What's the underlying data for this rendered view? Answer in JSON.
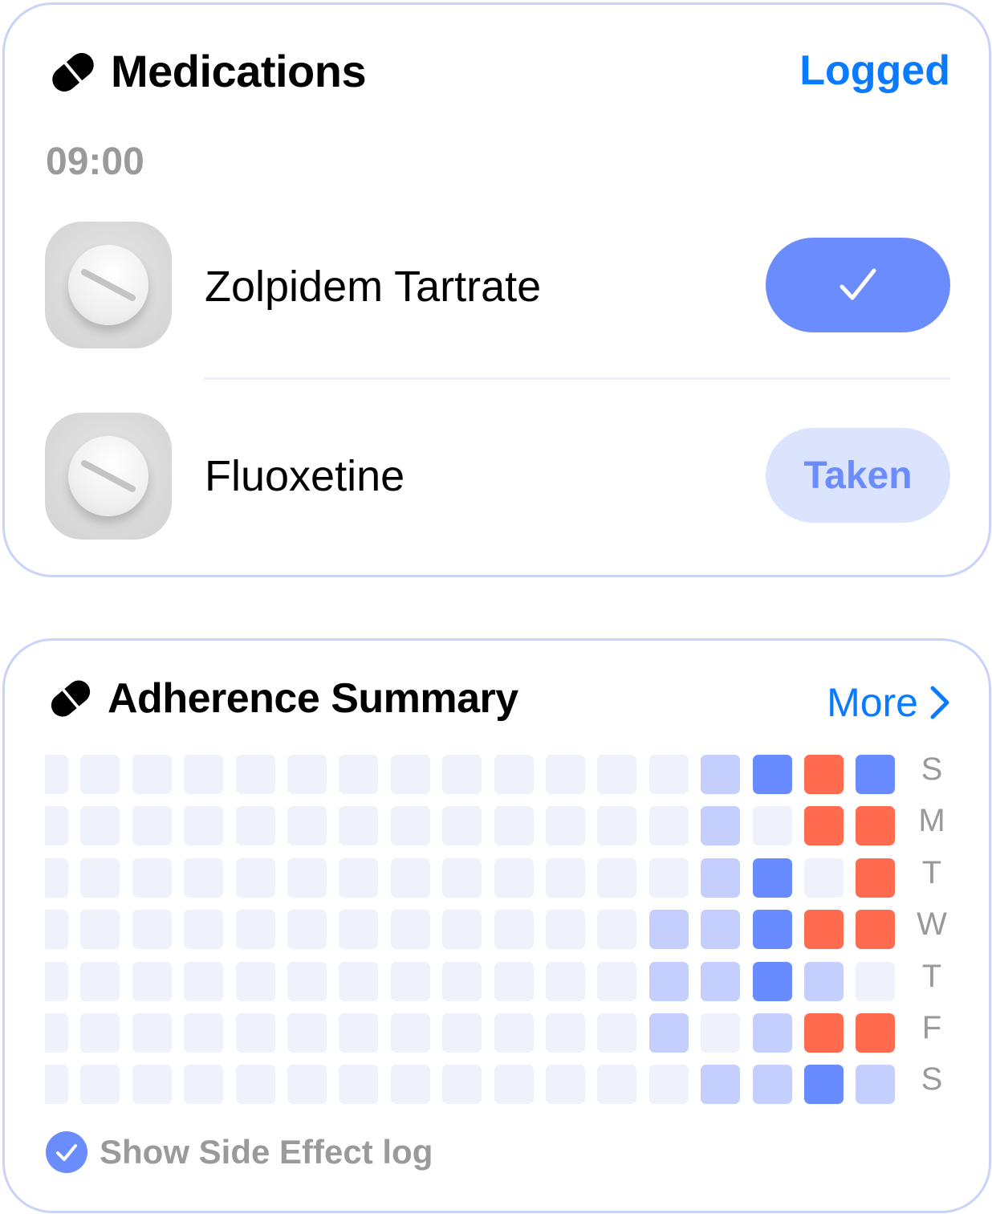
{
  "medications_card": {
    "title": "Medications",
    "icon": "pill-icon",
    "action_label": "Logged",
    "time": "09:00",
    "items": [
      {
        "name": "Zolpidem Tartrate",
        "status": "checked",
        "button_icon": "checkmark-icon"
      },
      {
        "name": "Fluoxetine",
        "status": "pending",
        "button_label": "Taken"
      }
    ]
  },
  "adherence_card": {
    "title": "Adherence Summary",
    "icon": "pill-icon",
    "more_label": "More",
    "day_labels": [
      "S",
      "M",
      "T",
      "W",
      "T",
      "F",
      "S"
    ],
    "legend_levels": {
      "0": "none",
      "1": "partial",
      "2": "taken",
      "3": "missed"
    },
    "colors": {
      "0": "#eff2fa",
      "1": "#c4cffd",
      "2": "#688cff",
      "3": "#ff6b4e"
    },
    "grid": [
      [
        0,
        0,
        0,
        0,
        0,
        0,
        0,
        0,
        0,
        0,
        0,
        0,
        0,
        1,
        2,
        3,
        2
      ],
      [
        0,
        0,
        0,
        0,
        0,
        0,
        0,
        0,
        0,
        0,
        0,
        0,
        0,
        1,
        0,
        3,
        3
      ],
      [
        0,
        0,
        0,
        0,
        0,
        0,
        0,
        0,
        0,
        0,
        0,
        0,
        0,
        1,
        2,
        0,
        3
      ],
      [
        0,
        0,
        0,
        0,
        0,
        0,
        0,
        0,
        0,
        0,
        0,
        0,
        1,
        1,
        2,
        3,
        3
      ],
      [
        0,
        0,
        0,
        0,
        0,
        0,
        0,
        0,
        0,
        0,
        0,
        0,
        1,
        1,
        2,
        1,
        0
      ],
      [
        0,
        0,
        0,
        0,
        0,
        0,
        0,
        0,
        0,
        0,
        0,
        0,
        1,
        0,
        1,
        3,
        3
      ],
      [
        0,
        0,
        0,
        0,
        0,
        0,
        0,
        0,
        0,
        0,
        0,
        0,
        0,
        1,
        1,
        2,
        1
      ]
    ],
    "side_effect_toggle": {
      "label": "Show Side Effect log",
      "checked": true
    }
  },
  "colors": {
    "accent": "#6a8cfd",
    "link": "#0a7aff",
    "taken_bg": "#dce3fd"
  }
}
